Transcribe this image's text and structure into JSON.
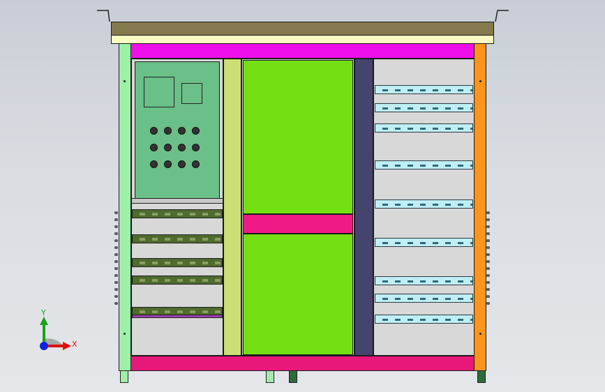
{
  "axis_triad": {
    "y_label": "Y",
    "x_label": "X"
  },
  "colors": {
    "roof_top": "#857a4e",
    "roof_trim": "#fbfbc3",
    "frame_top": "#ee10e8",
    "frame_bottom": "#e8187a",
    "left_post": "#9ef0a8",
    "right_post": "#ff9418",
    "gap_strip": "#ccdf74",
    "control_panel": "#6bbf88",
    "door": "#74e014",
    "door_gap": "#f01a86",
    "back_strip": "#44446e",
    "compartment": "#d8d8d8",
    "rail_green": "#4f6b2e",
    "rail_cyan": "#bfeef5"
  }
}
